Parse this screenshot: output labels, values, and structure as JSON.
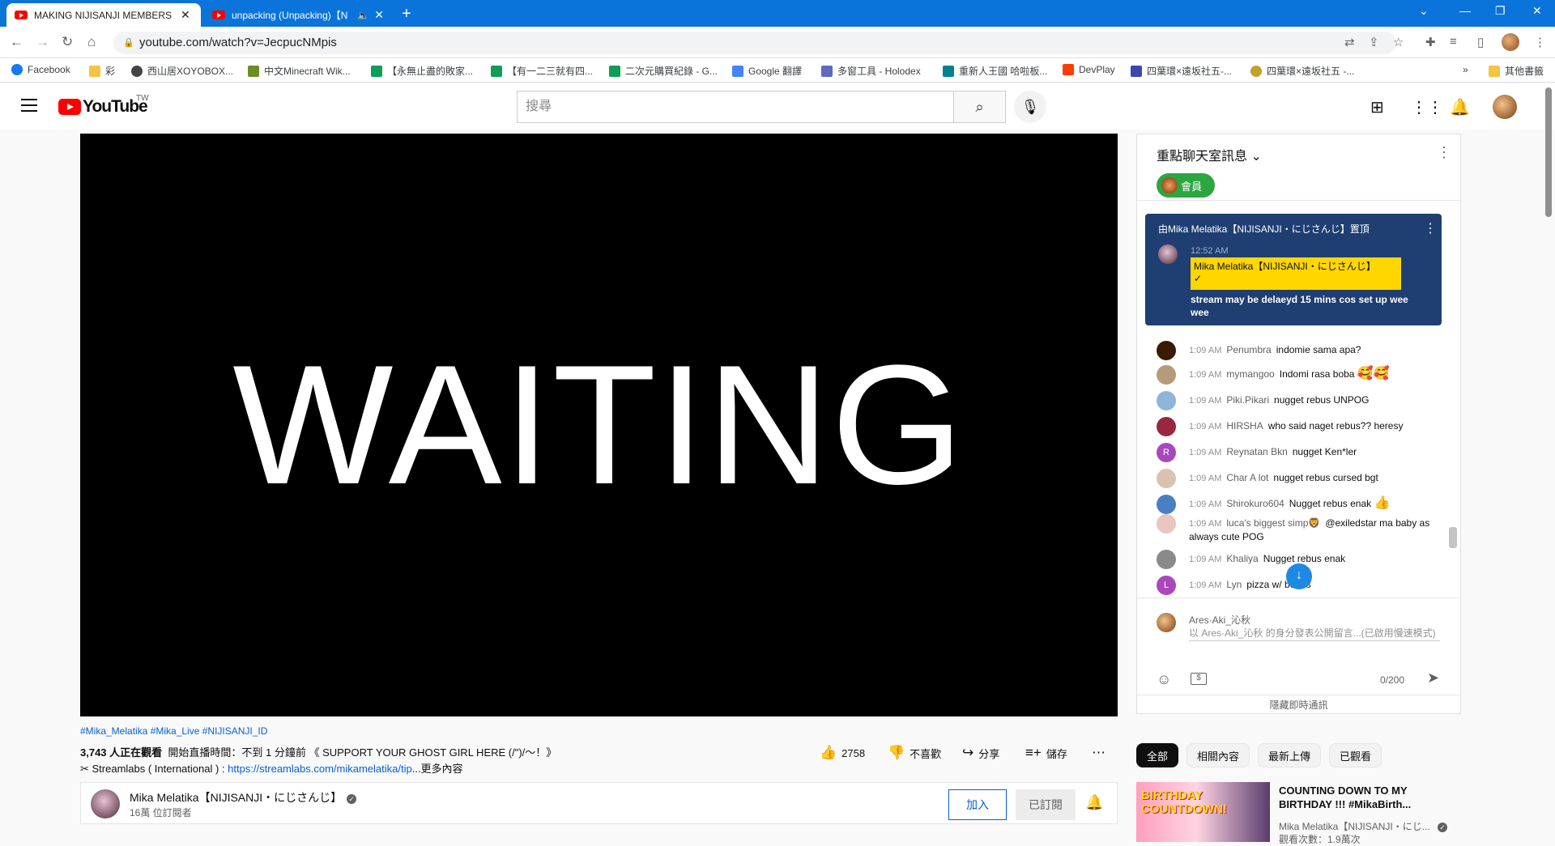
{
  "browser": {
    "tabs": [
      {
        "title": "MAKING NIJISANJI MEMBERS",
        "active": true
      },
      {
        "title": "unpacking (Unpacking)【N",
        "active": false
      }
    ],
    "url": "youtube.com/watch?v=JecpucNMpis",
    "bookmarks": [
      "Facebook",
      "彩",
      "西山居XOYOBOX...",
      "中文Minecraft Wik...",
      "【永無止盡的敗家...",
      "【有一二三就有四...",
      "二次元購買紀錄 - G...",
      "Google 翻譯",
      "多窗工具 - Holodex",
      "重新人王國 哈啦板...",
      "DevPlay",
      "四葉環×遠坂社五-...",
      "四葉環×遠坂社五 -..."
    ],
    "bookmarks_other": "其他書籤",
    "bookmarks_more": "»"
  },
  "youtube": {
    "logo": "YouTube",
    "country": "TW",
    "search_placeholder": "搜尋"
  },
  "video": {
    "screen_text": "WAITING",
    "hashtags": "#Mika_Melatika #Mika_Live #NIJISANJI_ID",
    "viewers": "3,743 人正在觀看",
    "started": "開始直播時間：不到 1 分鐘前 《 SUPPORT YOUR GHOST GIRL HERE (/\")/～！》",
    "desc_prefix": "✂ Streamlabs ( International ) : ",
    "desc_link": "https://streamlabs.com/mikamelatika/tip",
    "desc_more": "...更多內容",
    "likes": "2758",
    "dislike": "不喜歡",
    "share": "分享",
    "save": "儲存"
  },
  "channel": {
    "name": "Mika Melatika【NIJISANJI・にじさんじ】",
    "subs": "16萬 位訂閱者",
    "join": "加入",
    "subscribed": "已訂閱"
  },
  "chat": {
    "title": "重點聊天室訊息",
    "member_chip": "會員",
    "pinned": {
      "label": "由Mika Melatika【NIJISANJI・にじさんじ】置頂",
      "time": "12:52 AM",
      "author": "Mika Melatika【NIJISANJI・にじさんじ】",
      "message": "stream may be delaeyd 15 mins cos set up wee wee"
    },
    "messages": [
      {
        "time": "1:09 AM",
        "author": "Penumbra",
        "text": "indomie sama apa?",
        "avatar_color": "#3a1a00",
        "letter": "",
        "emoji": ""
      },
      {
        "time": "1:09 AM",
        "author": "mymangoo",
        "text": "Indomi rasa boba",
        "avatar_color": "#b59b7a",
        "letter": "",
        "emoji": "🥰🥰"
      },
      {
        "time": "1:09 AM",
        "author": "Piki.Pikari",
        "text": "nugget rebus UNPOG",
        "avatar_color": "#8fb5d9",
        "letter": "",
        "emoji": ""
      },
      {
        "time": "1:09 AM",
        "author": "HIRSHA",
        "text": "who said naget rebus?? heresy",
        "avatar_color": "#9a2740",
        "letter": "",
        "emoji": ""
      },
      {
        "time": "1:09 AM",
        "author": "Reynatan Bkn",
        "text": "nugget Ken*ler",
        "avatar_color": "#ab47bc",
        "letter": "R",
        "emoji": ""
      },
      {
        "time": "1:09 AM",
        "author": "Char A lot",
        "text": "nugget rebus cursed bgt",
        "avatar_color": "#d9c2b0",
        "letter": "",
        "emoji": ""
      },
      {
        "time": "1:09 AM",
        "author": "Shirokuro604",
        "text": "Nugget rebus enak",
        "avatar_color": "#4a7fc1",
        "letter": "",
        "emoji": "👍"
      },
      {
        "time": "1:09 AM",
        "author": "luca's biggest simp🦁",
        "text": "@exiledstar ma baby as always cute POG",
        "avatar_color": "#e8c7c0",
        "letter": "",
        "emoji": ""
      },
      {
        "time": "1:09 AM",
        "author": "Khaliya",
        "text": "Nugget rebus enak",
        "avatar_color": "#8a8a8a",
        "letter": "",
        "emoji": ""
      },
      {
        "time": "1:09 AM",
        "author": "Lyn",
        "text": "pizza w/ beans",
        "avatar_color": "#ab47bc",
        "letter": "L",
        "emoji": ""
      }
    ],
    "input_user": "Ares·Aki_沁秋",
    "input_placeholder": "以 Ares·Aki_沁秋 的身分發表公開留言...(已啟用慢速模式)",
    "char_count": "0/200",
    "hide_chat": "隱藏即時通訊"
  },
  "filters": [
    "全部",
    "相關內容",
    "最新上傳",
    "已觀看"
  ],
  "recommendation": {
    "thumb_text": "BIRTHDAY COUNTDOWN!",
    "title": "COUNTING DOWN TO MY BIRTHDAY !!! #MikaBirth...",
    "channel": "Mika Melatika【NIJISANJI・にじ...",
    "meta": "觀看次數：1.9萬次"
  }
}
